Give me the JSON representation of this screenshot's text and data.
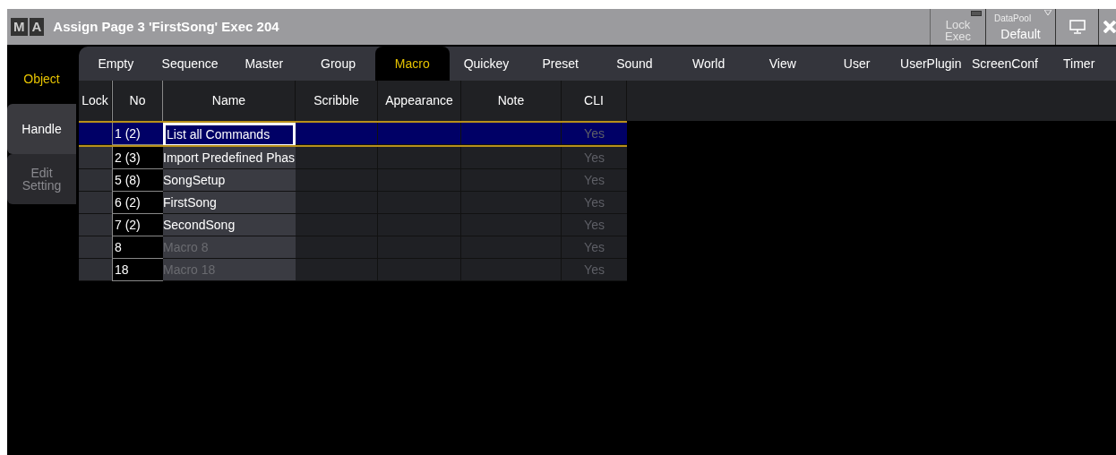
{
  "window": {
    "logo": [
      "M",
      "A"
    ],
    "title": "Assign Page 3 'FirstSong' Exec 204"
  },
  "title_buttons": {
    "lock_exec": {
      "label": [
        "Lock",
        "Exec"
      ],
      "disabled": true
    },
    "datapool": {
      "caption": "DataPool",
      "value": "Default"
    }
  },
  "side_tabs": [
    {
      "label": "Object",
      "selected": true,
      "disabled": false
    },
    {
      "label": "Handle",
      "selected": false,
      "disabled": false
    },
    {
      "label": "Edit Setting",
      "selected": false,
      "disabled": true
    }
  ],
  "tabs": [
    {
      "label": "Empty",
      "selected": false
    },
    {
      "label": "Sequence",
      "selected": false
    },
    {
      "label": "Master",
      "selected": false
    },
    {
      "label": "Group",
      "selected": false
    },
    {
      "label": "Macro",
      "selected": true
    },
    {
      "label": "Quickey",
      "selected": false
    },
    {
      "label": "Preset",
      "selected": false
    },
    {
      "label": "Sound",
      "selected": false
    },
    {
      "label": "World",
      "selected": false
    },
    {
      "label": "View",
      "selected": false
    },
    {
      "label": "User",
      "selected": false
    },
    {
      "label": "UserPlugin",
      "selected": false
    },
    {
      "label": "ScreenConf",
      "selected": false
    },
    {
      "label": "Timer",
      "selected": false
    }
  ],
  "table": {
    "columns": [
      "Lock",
      "No",
      "Name",
      "Scribble",
      "Appearance",
      "Note",
      "CLI"
    ],
    "rows": [
      {
        "no": "1 (2)",
        "name": "List all Commands",
        "name_default": false,
        "cli": "Yes",
        "selected": true
      },
      {
        "no": "2 (3)",
        "name": "Import Predefined Phas",
        "name_default": false,
        "cli": "Yes",
        "selected": false
      },
      {
        "no": "5 (8)",
        "name": "SongSetup",
        "name_default": false,
        "cli": "Yes",
        "selected": false
      },
      {
        "no": "6 (2)",
        "name": "FirstSong",
        "name_default": false,
        "cli": "Yes",
        "selected": false
      },
      {
        "no": "7 (2)",
        "name": "SecondSong",
        "name_default": false,
        "cli": "Yes",
        "selected": false
      },
      {
        "no": "8",
        "name": "Macro 8",
        "name_default": true,
        "cli": "Yes",
        "selected": false
      },
      {
        "no": "18",
        "name": "Macro 18",
        "name_default": true,
        "cli": "Yes",
        "selected": false
      }
    ]
  }
}
